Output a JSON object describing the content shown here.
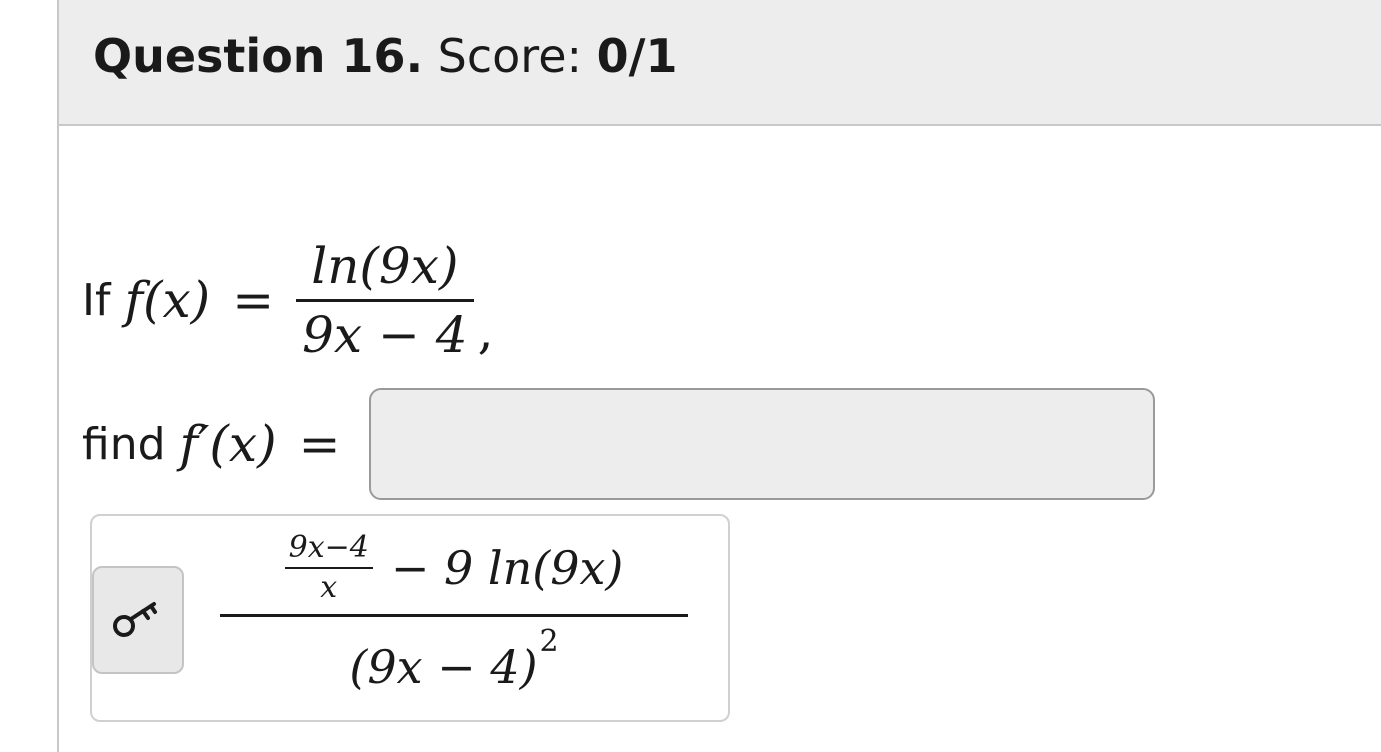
{
  "header": {
    "question_label": "Question 16.",
    "score_label": "Score:",
    "score_value": "0/1"
  },
  "problem": {
    "lead_word": "If",
    "function_lhs": "f(x)",
    "equals": "=",
    "numerator": "ln(9x)",
    "denominator": "9x − 4",
    "trailing_comma": ",",
    "find_word": "find",
    "derivative_lhs": "f′(x)"
  },
  "answer_input": {
    "value": "",
    "placeholder": ""
  },
  "preview": {
    "icon": "key-icon",
    "inner_numerator": "9x−4",
    "inner_denominator": "x",
    "minus_term": "− 9 ln(9x)",
    "denominator_base": "(9x − 4)",
    "denominator_exponent": "2"
  },
  "colors": {
    "header_bg": "#ededed",
    "input_bg": "#ededed",
    "border": "#c8c8c8"
  }
}
